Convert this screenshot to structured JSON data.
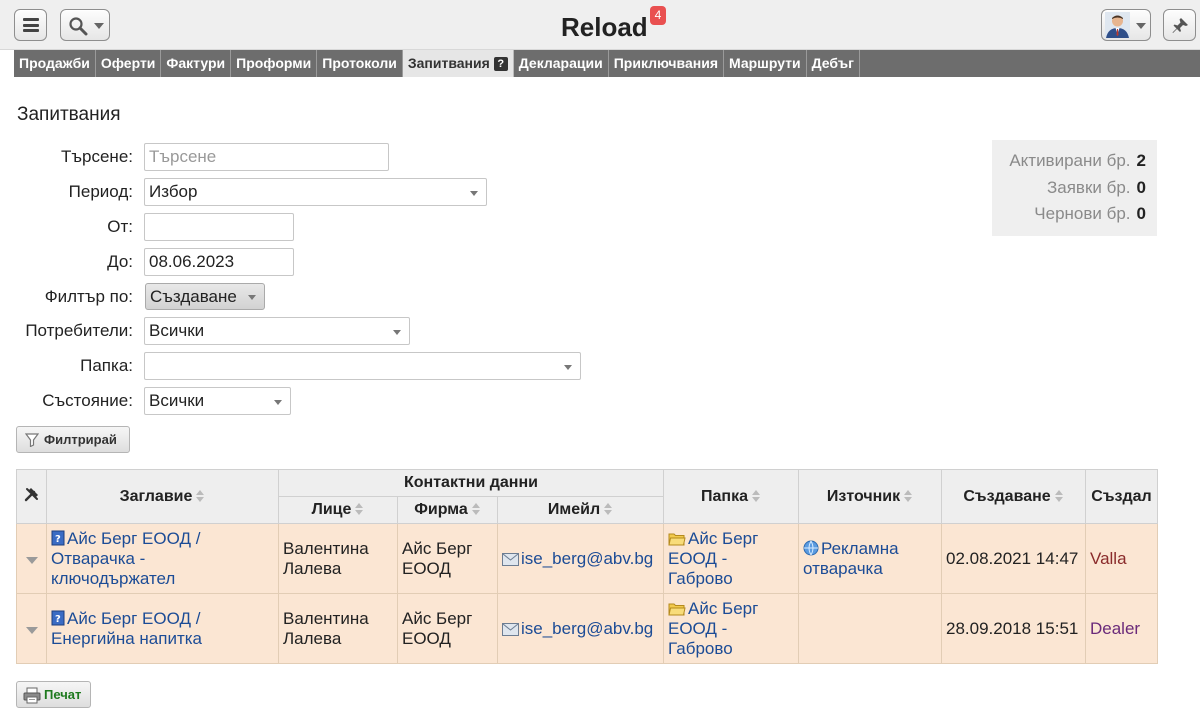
{
  "app": {
    "title": "Reload",
    "badge": "4"
  },
  "nav": {
    "tabs": [
      {
        "label": "Продажби"
      },
      {
        "label": "Оферти"
      },
      {
        "label": "Фактури"
      },
      {
        "label": "Проформи"
      },
      {
        "label": "Протоколи"
      },
      {
        "label": "Запитвания",
        "active": true
      },
      {
        "label": "Декларации"
      },
      {
        "label": "Приключвания"
      },
      {
        "label": "Маршрути"
      },
      {
        "label": "Дебъг"
      }
    ],
    "help_mark": "?"
  },
  "page": {
    "title": "Запитвания"
  },
  "form": {
    "search": {
      "label": "Търсене:",
      "placeholder": "Търсене",
      "value": ""
    },
    "period": {
      "label": "Период:",
      "value": "Избор"
    },
    "from": {
      "label": "От:",
      "value": ""
    },
    "to": {
      "label": "До:",
      "value": "08.06.2023"
    },
    "filter_by": {
      "label": "Филтър по:",
      "value": "Създаване"
    },
    "users": {
      "label": "Потребители:",
      "value": "Всички"
    },
    "folder": {
      "label": "Папка:",
      "value": ""
    },
    "state": {
      "label": "Състояние:",
      "value": "Всички"
    },
    "filter_button": "Филтрирай"
  },
  "stats": {
    "activated": {
      "label": "Активирани бр.",
      "value": "2"
    },
    "requests": {
      "label": "Заявки бр.",
      "value": "0"
    },
    "drafts": {
      "label": "Чернови бр.",
      "value": "0"
    }
  },
  "table": {
    "headers": {
      "title": "Заглавие",
      "contact": "Контактни данни",
      "person": "Лице",
      "company": "Фирма",
      "email": "Имейл",
      "folder": "Папка",
      "source": "Източник",
      "created": "Създаване",
      "creator": "Създал"
    },
    "rows": [
      {
        "title": "Айс Берг ЕООД / Отварачка - ключодържател",
        "person": "Валентина Лалева",
        "company": "Айс Берг ЕООД",
        "email": "ise_berg@abv.bg",
        "folder": "Айс Берг ЕООД - Габрово",
        "source": "Рекламна отварачка",
        "created": "02.08.2021 14:47",
        "creator": "Valla"
      },
      {
        "title": "Айс Берг ЕООД / Енергийна напитка",
        "person": "Валентина Лалева",
        "company": "Айс Берг ЕООД",
        "email": "ise_berg@abv.bg",
        "folder": "Айс Берг ЕООД - Габрово",
        "source": "",
        "created": "28.09.2018 15:51",
        "creator": "Dealer"
      }
    ]
  },
  "print_button": "Печат",
  "colors": {
    "nav_bg": "#6d6d6d",
    "row_bg": "#fbe6d3",
    "link": "#1c4c96",
    "badge": "#e95050"
  }
}
